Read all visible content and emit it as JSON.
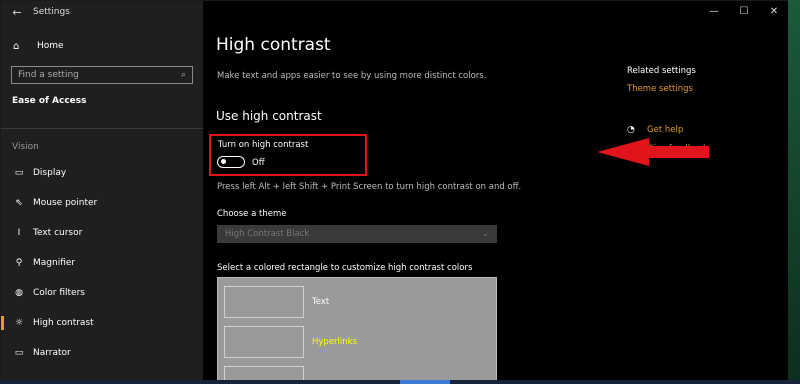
{
  "window": {
    "title": "Settings",
    "controls": {
      "minimize": "—",
      "maximize": "☐",
      "close": "✕"
    }
  },
  "sidebar": {
    "back_icon": "←",
    "home": {
      "icon": "⌂",
      "label": "Home"
    },
    "search": {
      "placeholder": "Find a setting",
      "icon": "⌕"
    },
    "section": "Ease of Access",
    "group": "Vision",
    "items": [
      {
        "icon": "▭",
        "label": "Display"
      },
      {
        "icon": "⇖",
        "label": "Mouse pointer"
      },
      {
        "icon": "I",
        "label": "Text cursor"
      },
      {
        "icon": "⚲",
        "label": "Magnifier"
      },
      {
        "icon": "◍",
        "label": "Color filters"
      },
      {
        "icon": "☼",
        "label": "High contrast"
      },
      {
        "icon": "▭",
        "label": "Narrator"
      }
    ]
  },
  "main": {
    "title": "High contrast",
    "description": "Make text and apps easier to see by using more distinct colors.",
    "subtitle": "Use high contrast",
    "toggle": {
      "label": "Turn on high contrast",
      "state": "Off"
    },
    "hint": "Press left Alt + left Shift + Print Screen to turn high contrast on and off.",
    "theme": {
      "label": "Choose a theme",
      "value": "High Contrast Black"
    },
    "customize_label": "Select a colored rectangle to customize high contrast colors",
    "swatches": [
      {
        "label": "Text",
        "color": "#ffffff"
      },
      {
        "label": "Hyperlinks",
        "color": "#ffff00"
      }
    ]
  },
  "related": {
    "title": "Related settings",
    "link": "Theme settings",
    "help": "Get help",
    "feedback": "Give feedback"
  },
  "colors": {
    "accent": "#e49b2a",
    "highlight_box": "#e0151b"
  }
}
